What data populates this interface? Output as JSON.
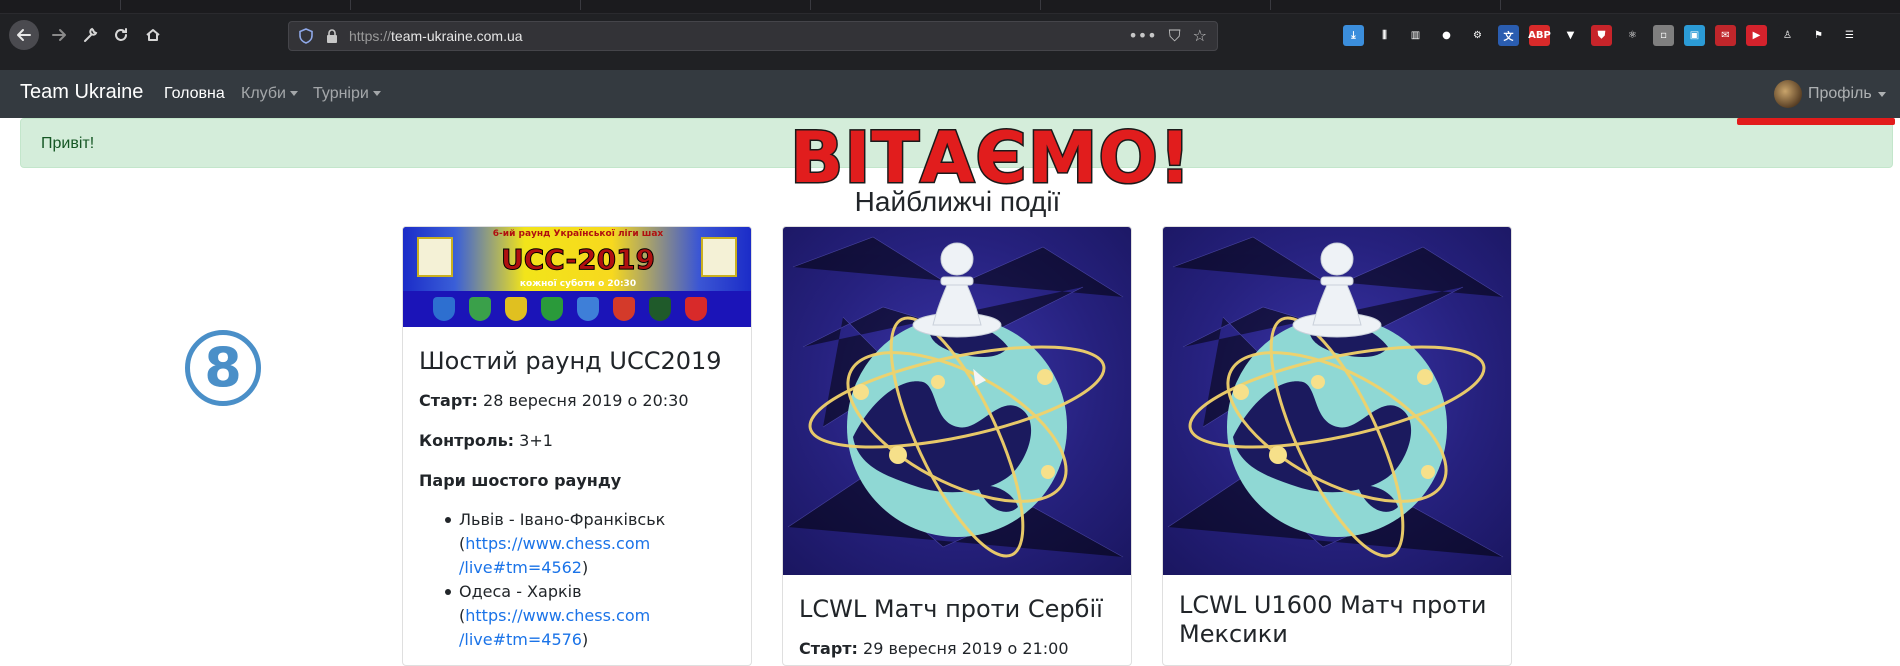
{
  "browser": {
    "url_scheme": "https://",
    "url_host": "team-ukraine.com.ua",
    "url_actions": [
      "•••",
      "⛉",
      "☆"
    ],
    "toolbar_icons": [
      {
        "name": "download-icon",
        "color": "#3b8edc",
        "glyph": "⤓"
      },
      {
        "name": "library-icon",
        "color": "#202124",
        "glyph": "⫼"
      },
      {
        "name": "sidebar-icon",
        "color": "#202124",
        "glyph": "▥"
      },
      {
        "name": "account-icon",
        "color": "#202124",
        "glyph": "●"
      },
      {
        "name": "extension-icon",
        "color": "#202124",
        "glyph": "⚙"
      },
      {
        "name": "translate-icon",
        "color": "#2a5db0",
        "glyph": "文"
      },
      {
        "name": "adblock-icon",
        "color": "#d82a2a",
        "glyph": "ABP"
      },
      {
        "name": "vue-icon",
        "color": "#202124",
        "glyph": "▼"
      },
      {
        "name": "ublock-icon",
        "color": "#c7242a",
        "glyph": "⛊"
      },
      {
        "name": "react-icon",
        "color": "#202124",
        "glyph": "⚛"
      },
      {
        "name": "screenshot-icon",
        "color": "#7f7f7f",
        "glyph": "▫"
      },
      {
        "name": "save-icon",
        "color": "#2b9bd6",
        "glyph": "▣"
      },
      {
        "name": "gift-icon",
        "color": "#c0262b",
        "glyph": "✉"
      },
      {
        "name": "video-icon",
        "color": "#d4222c",
        "glyph": "▶"
      },
      {
        "name": "figure-icon",
        "color": "#202124",
        "glyph": "♙"
      },
      {
        "name": "flag-icon",
        "color": "#202124",
        "glyph": "⚑"
      },
      {
        "name": "menu-icon",
        "color": "#202124",
        "glyph": "☰"
      }
    ]
  },
  "navbar": {
    "brand": "Team Ukraine",
    "links": [
      {
        "label": "Головна",
        "active": true
      },
      {
        "label": "Клуби",
        "dropdown": true
      },
      {
        "label": "Турніри",
        "dropdown": true
      }
    ],
    "profile_label": "Профіль"
  },
  "alert": {
    "text": "Привіт!"
  },
  "banner": {
    "text": "ВІТАЄМО!"
  },
  "section_title": "Найближчі події",
  "step_badge": "8",
  "cards": [
    {
      "image": {
        "subtitle": "6-ий раунд Української ліги шах",
        "title": "UCC-2019",
        "when": "кожної суботи о 20:30"
      },
      "title": "Шостий раунд UCC2019",
      "start_label": "Старт:",
      "start_value": "28 вересня 2019 о 20:30",
      "control_label": "Контроль:",
      "control_value": "3+1",
      "pairs_heading": "Пари шостого раунду",
      "pairs": [
        {
          "teams": "Львів - Івано-Франківськ",
          "open": "(",
          "link1": "https://www.chess.com",
          "link2": "/live#tm=4562",
          "close": ")"
        },
        {
          "teams": "Одеса - Харків",
          "open": "(",
          "link1": "https://www.chess.com",
          "link2": "/live#tm=4576",
          "close": ")"
        }
      ]
    },
    {
      "title": "LCWL Матч проти Сербії",
      "start_label": "Старт:",
      "start_value": "29 вересня 2019 о 21:00"
    },
    {
      "title_line1": "LCWL U1600 Матч проти",
      "title_line2": "Мексики"
    }
  ]
}
